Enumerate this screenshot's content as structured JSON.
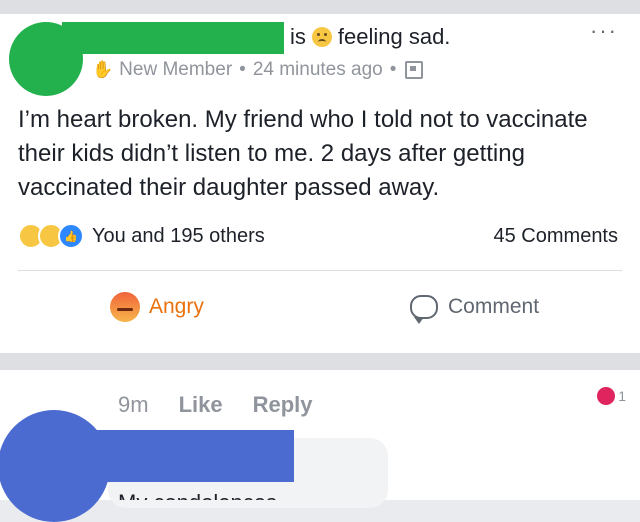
{
  "post": {
    "header": {
      "is": "is",
      "feeling": "feeling sad.",
      "feeling_icon": "sad-face-icon"
    },
    "more_label": "···",
    "meta": {
      "badge": "New Member",
      "sep1": "•",
      "time": "24 minutes ago",
      "sep2": "•"
    },
    "text": "I’m heart broken. My friend who I told not to vaccinate their kids didn’t listen to me. 2 days after getting vaccinated their daughter passed away.",
    "reactions": {
      "summary": "You and 195 others",
      "icons": [
        "sad-reaction-icon",
        "wow-reaction-icon",
        "like-reaction-icon"
      ]
    },
    "comments_count": "45 Comments",
    "actions": {
      "angry_label": "Angry",
      "comment_label": "Comment"
    },
    "colors": {
      "angry": "#e9710f",
      "muted": "#606770"
    }
  },
  "comment": {
    "time": "9m",
    "like_label": "Like",
    "reply_label": "Reply",
    "reaction_count": "1",
    "text": "My condolences"
  }
}
